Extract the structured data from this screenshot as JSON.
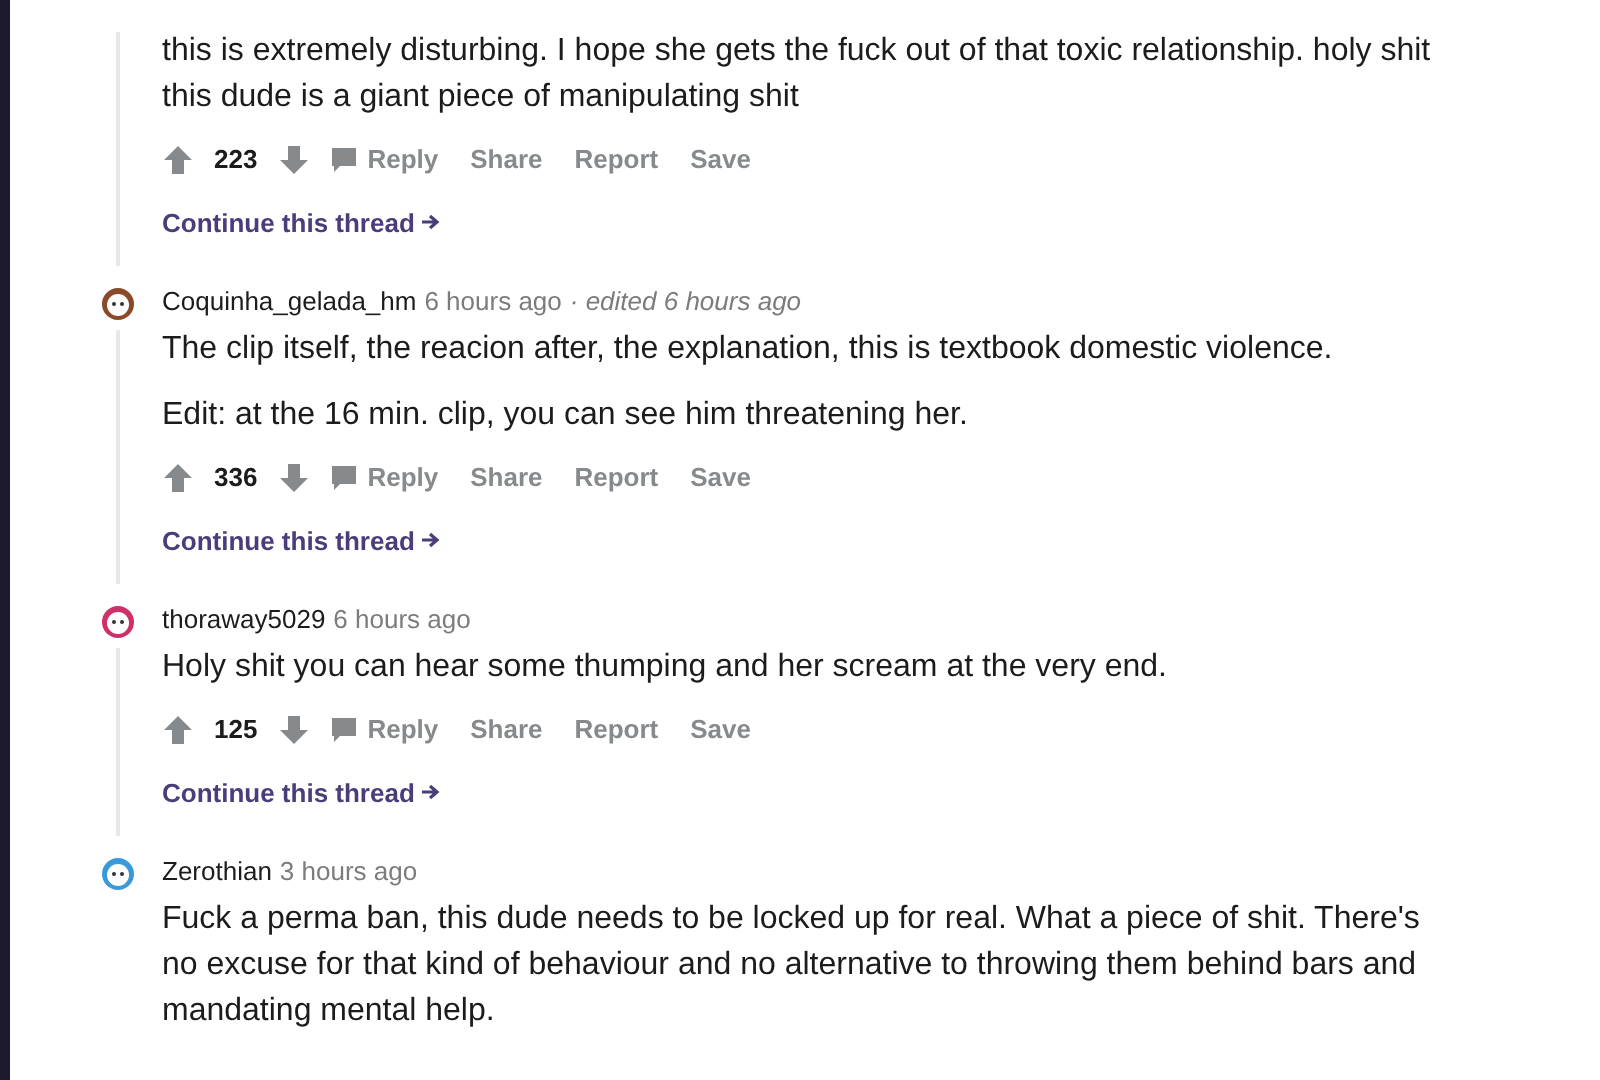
{
  "comments": [
    {
      "paragraphs": [
        "this is extremely disturbing. I hope she gets the fuck out of that toxic relationship. holy shit this dude is a giant piece of manipulating shit"
      ],
      "score": "223",
      "actions": [
        "Reply",
        "Share",
        "Report",
        "Save"
      ],
      "continue": "Continue this thread"
    },
    {
      "author": "Coquinha_gelada_hm",
      "time": "6 hours ago",
      "edited": "· edited 6 hours ago",
      "color": "#8a4a2a",
      "paragraphs": [
        "The clip itself, the reacion after, the explanation, this is textbook domestic violence.",
        "Edit: at the 16 min. clip, you can see him threatening her."
      ],
      "score": "336",
      "actions": [
        "Reply",
        "Share",
        "Report",
        "Save"
      ],
      "continue": "Continue this thread"
    },
    {
      "author": "thoraway5029",
      "time": "6 hours ago",
      "color": "#d0306a",
      "paragraphs": [
        "Holy shit you can hear some thumping and her scream at the very end."
      ],
      "score": "125",
      "actions": [
        "Reply",
        "Share",
        "Report",
        "Save"
      ],
      "continue": "Continue this thread"
    },
    {
      "author": "Zerothian",
      "time": "3 hours ago",
      "color": "#3a9ad9",
      "paragraphs": [
        "Fuck a perma ban, this dude needs to be locked up for real. What a piece of shit. There's no excuse for that kind of behaviour and no alternative to throwing them behind bars and mandating mental help."
      ]
    }
  ]
}
